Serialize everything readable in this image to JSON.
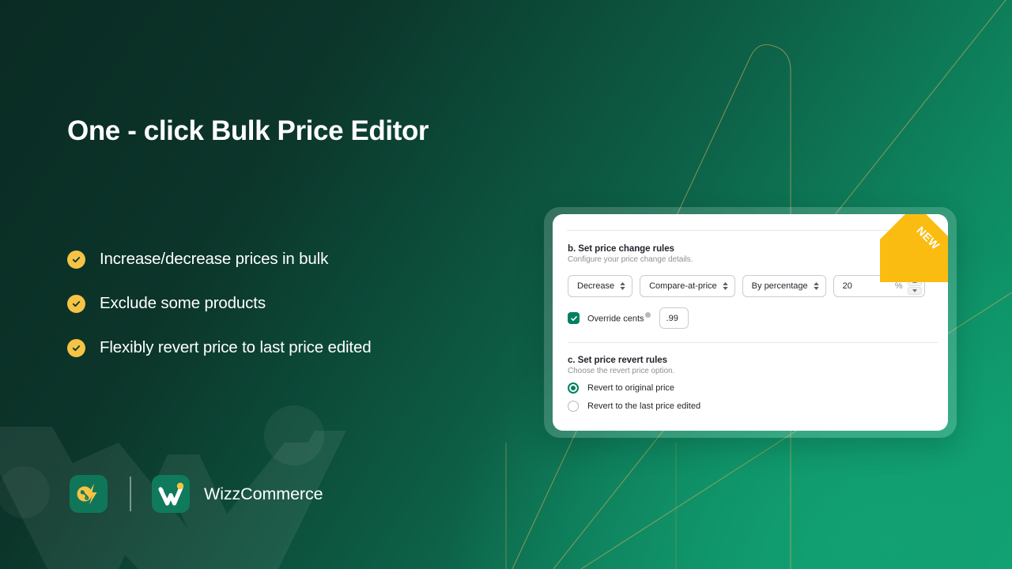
{
  "headline": "One - click Bulk Price Editor",
  "features": [
    {
      "icon": "check-circle-icon",
      "label": "Increase/decrease prices in bulk"
    },
    {
      "icon": "check-circle-icon",
      "label": "Exclude some products"
    },
    {
      "icon": "check-circle-icon",
      "label": "Flexibly revert price to last price edited"
    }
  ],
  "brand": {
    "app_icon": "percent-bolt-icon",
    "logo_icon": "wizz-w-icon",
    "name": "WizzCommerce"
  },
  "badge": {
    "label": "NEW"
  },
  "card": {
    "price_change": {
      "title": "b. Set price change rules",
      "subtitle": "Configure your price change details.",
      "direction_select": {
        "value": "Decrease",
        "icon": "chevron-updown-icon"
      },
      "target_select": {
        "value": "Compare-at-price",
        "icon": "chevron-updown-icon"
      },
      "method_select": {
        "value": "By percentage",
        "icon": "chevron-updown-icon"
      },
      "amount_input": {
        "value": "20",
        "suffix": "%",
        "increment_icon": "chevron-up-icon",
        "decrement_icon": "chevron-down-icon"
      },
      "override_cents": {
        "checked": true,
        "checkbox_icon": "checkmark-icon",
        "label": "Override cents",
        "help_icon": "help-circle-icon",
        "value": ".99"
      }
    },
    "price_revert": {
      "title": "c. Set price revert rules",
      "subtitle": "Choose the revert price option.",
      "options": [
        {
          "label": "Revert to original price",
          "selected": true
        },
        {
          "label": "Revert to the last price edited",
          "selected": false
        }
      ]
    }
  },
  "colors": {
    "bg_dark": "#0b2f26",
    "bg_light": "#0fa273",
    "accent_amber": "#f6c344",
    "ribbon_amber": "#fbbc12",
    "brand_green": "#008060",
    "line_gold": "#d9b05c"
  }
}
